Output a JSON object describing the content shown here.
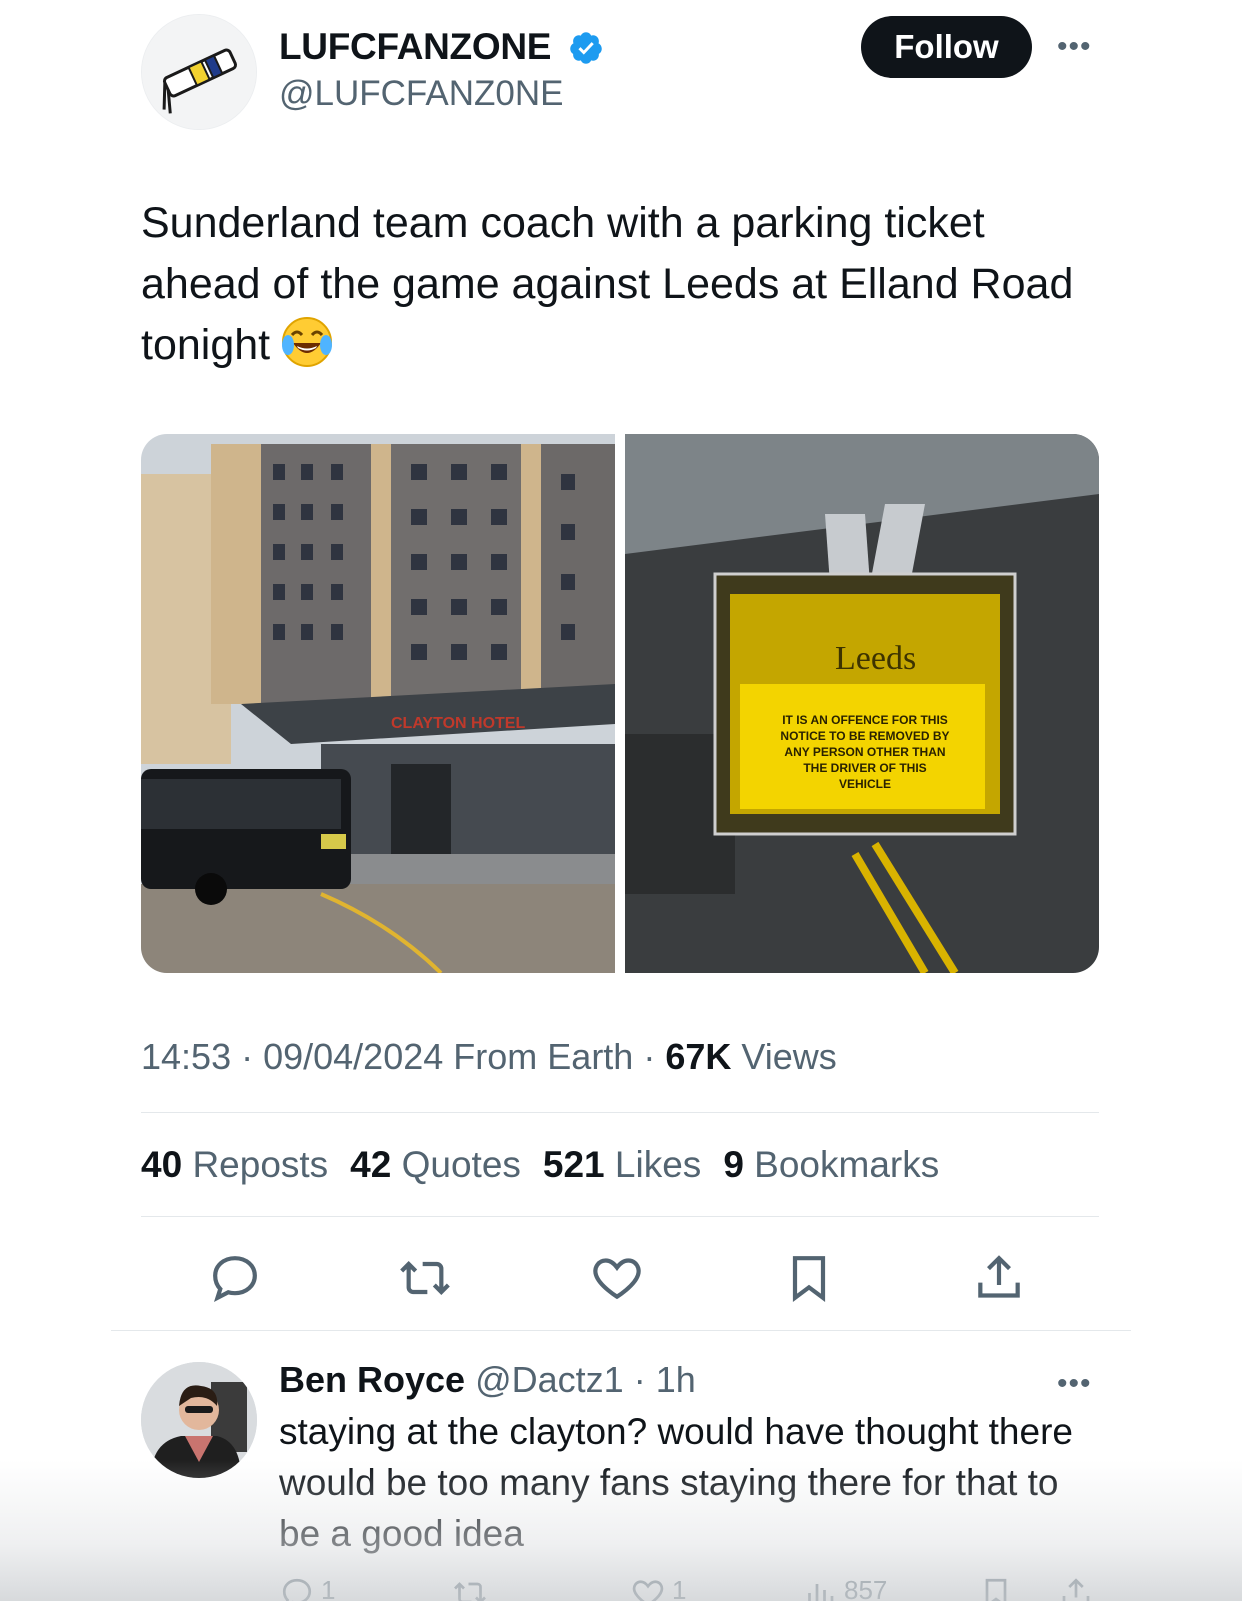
{
  "account": {
    "name": "LUFCFANZONE",
    "handle": "@LUFCFANZ0NE",
    "verified": true,
    "avatar_icon": "scarf-logo-icon"
  },
  "header": {
    "follow_label": "Follow",
    "more_label": "•••"
  },
  "tweet": {
    "text": "Sunderland team coach with a parking ticket ahead of the game against Leeds at Elland Road tonight",
    "emoji": "face-with-tears-of-joy",
    "media": [
      {
        "description_icon": "hotel-photo"
      },
      {
        "description_icon": "parking-ticket-photo",
        "ticket_lines": [
          "IT IS AN OFFENCE FOR THIS",
          "NOTICE TO BE REMOVED BY",
          "ANY PERSON OTHER THAN",
          "THE DRIVER OF THIS",
          "VEHICLE"
        ],
        "ticket_logo": "Leeds"
      }
    ],
    "time": "14:53",
    "date": "09/04/2024",
    "source": "From Earth",
    "views_count": "67K",
    "views_label": "Views"
  },
  "stats": {
    "reposts_count": "40",
    "reposts_label": "Reposts",
    "quotes_count": "42",
    "quotes_label": "Quotes",
    "likes_count": "521",
    "likes_label": "Likes",
    "bookmarks_count": "9",
    "bookmarks_label": "Bookmarks"
  },
  "hotel_sign": "CLAYTON HOTEL",
  "reply": {
    "name": "Ben Royce",
    "handle": "@Dactz1",
    "time": "1h",
    "text": "staying at the clayton? would have thought there would be too many fans staying there for that to be a good idea",
    "reply_count": "1",
    "like_count": "1",
    "views": "857",
    "colors": {
      "text": "#0f1419",
      "muted": "#536471",
      "verified": "#1d9bf0"
    }
  }
}
